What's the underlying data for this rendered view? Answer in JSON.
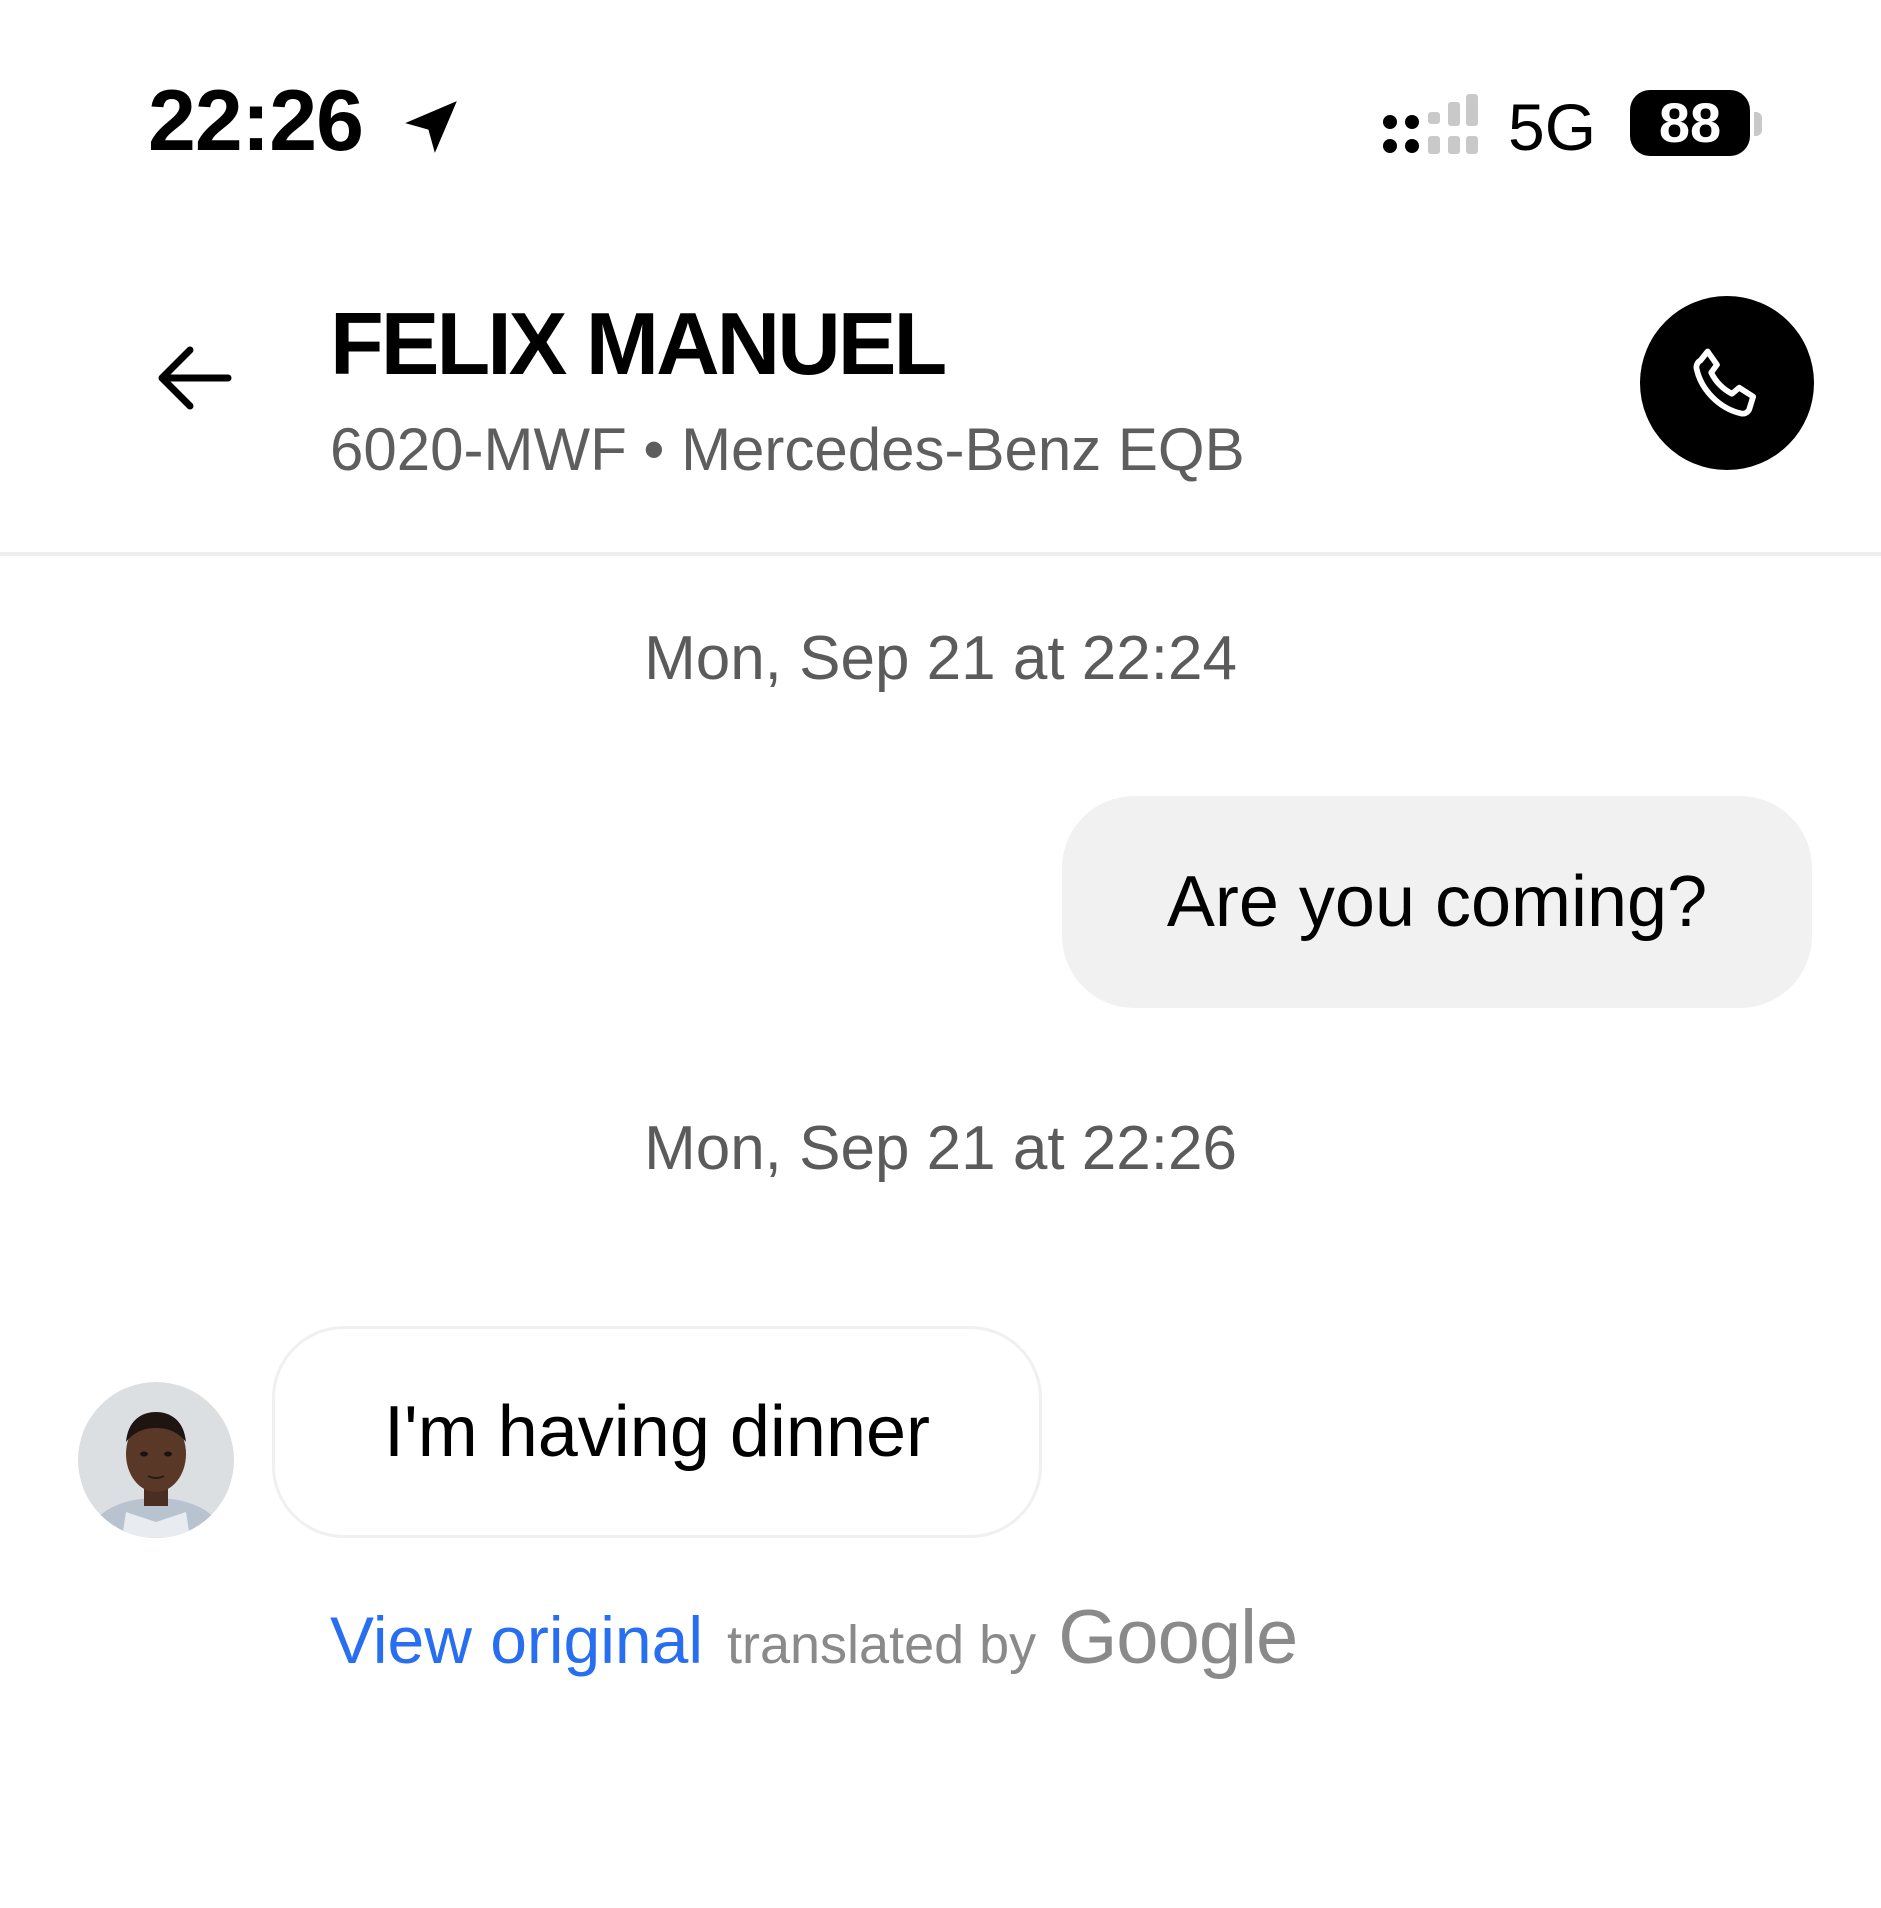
{
  "status_bar": {
    "time": "22:26",
    "network": "5G",
    "battery": "88",
    "icons": [
      "location-arrow-icon",
      "signal-icon",
      "battery-icon"
    ]
  },
  "header": {
    "contact_name": "FELIX MANUEL",
    "vehicle_info": "6020-MWF • Mercedes-Benz EQB",
    "icons": [
      "back-arrow-icon",
      "phone-icon"
    ]
  },
  "conversation": {
    "timestamp_1": "Mon, Sep 21 at 22:24",
    "outgoing_message": "Are you coming?",
    "timestamp_2": "Mon, Sep 21 at 22:26",
    "incoming_message": "I'm having dinner",
    "view_original_label": "View original",
    "translated_by_label": "translated by",
    "translation_provider": "Google"
  },
  "colors": {
    "link": "#276ef1",
    "bubble_outgoing": "#f1f1f1",
    "secondary_text": "#5e5e5e",
    "call_button": "#000000"
  }
}
